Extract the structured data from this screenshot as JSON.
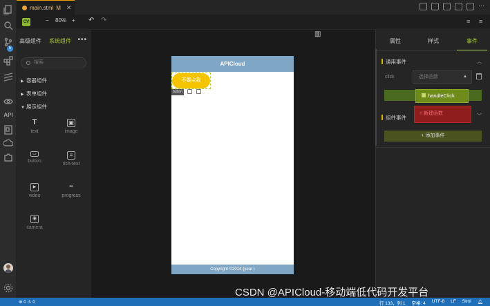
{
  "tab": {
    "filename": "main.stml",
    "modified": "M",
    "close": "✕"
  },
  "toolbar": {
    "zoom_minus": "−",
    "zoom": "80%",
    "zoom_plus": "+",
    "undo": "↶",
    "redo": "↷"
  },
  "activity": {
    "api": "API",
    "badge": "5"
  },
  "left": {
    "tab_advanced": "高级组件",
    "tab_system": "系统组件",
    "more": "•••",
    "search_placeholder": "搜索",
    "categories": [
      "容器组件",
      "表单组件",
      "展示组件"
    ],
    "components": [
      {
        "label": "text",
        "icon": "T"
      },
      {
        "label": "image",
        "icon": "▣"
      },
      {
        "label": "button",
        "icon": "▭"
      },
      {
        "label": "rich-text",
        "icon": "≡"
      },
      {
        "label": "video",
        "icon": "▶"
      },
      {
        "label": "progress",
        "icon": "━"
      },
      {
        "label": "camera",
        "icon": "◉"
      }
    ]
  },
  "phone": {
    "title": "APICloud",
    "button_text": "不要点我",
    "button_tag": "button",
    "footer": "Copyright ©2014-{year }"
  },
  "right": {
    "tabs": [
      "属性",
      "样式",
      "事件"
    ],
    "section_general": "通用事件",
    "click_label": "click",
    "select_placeholder": "选择函数",
    "dd_option_1": "handleClick",
    "dd_option_2": "+ 新建函数",
    "section_component": "组件事件",
    "add_event": "+ 添加事件"
  },
  "status": {
    "left": "⊗ 0 ⚠ 0",
    "line_col": "行 133，列 1",
    "spaces": "空格: 4",
    "encoding": "UTF-8",
    "eol": "LF",
    "lang": "Stml"
  },
  "watermark": "CSDN @APICloud-移动端低代码开发平台"
}
